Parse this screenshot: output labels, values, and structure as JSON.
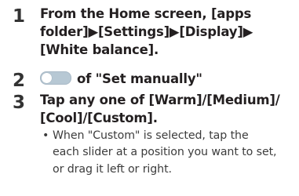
{
  "steps": [
    {
      "number": "1",
      "lines": [
        "From the Home screen, [apps",
        "folder]▶[Settings]▶[Display]▶",
        "[White balance]."
      ]
    },
    {
      "number": "2",
      "text": "of \"Set manually\""
    },
    {
      "number": "3",
      "lines": [
        "Tap any one of [Warm]/[Medium]/",
        "[Cool]/[Custom]."
      ],
      "note": {
        "bullet": "•",
        "lines": [
          "When \"Custom\" is selected, tap the",
          "each slider at a position you want to set,",
          "or drag it left or right."
        ]
      }
    }
  ]
}
